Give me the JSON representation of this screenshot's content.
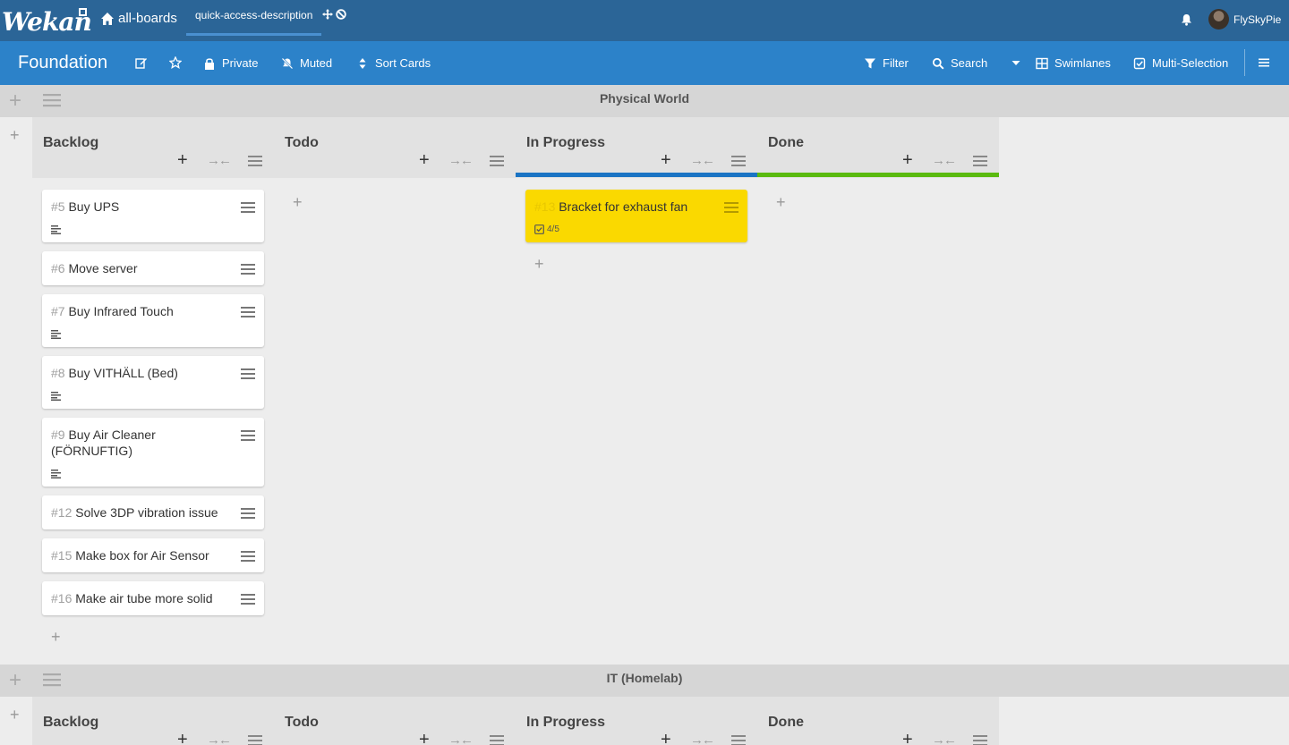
{
  "header": {
    "logo": "Wekan",
    "all_boards": "all-boards",
    "quick_access": "quick-access-description",
    "user": "FlySkyPie"
  },
  "board": {
    "title": "Foundation",
    "private": "Private",
    "muted": "Muted",
    "sort_cards": "Sort Cards",
    "filter": "Filter",
    "search": "Search",
    "swimlanes": "Swimlanes",
    "multi_selection": "Multi-Selection"
  },
  "colors": {
    "header": "#2b6597",
    "boardbar": "#2c82c9",
    "in_progress": "#1a74c4",
    "done": "#5aba0f",
    "yellow_card": "#fad900"
  },
  "swimlanes": [
    {
      "title": "Physical World",
      "lists": [
        {
          "title": "Backlog",
          "cards": [
            {
              "num": "#5",
              "title": "Buy UPS",
              "desc": true
            },
            {
              "num": "#6",
              "title": "Move server"
            },
            {
              "num": "#7",
              "title": "Buy Infrared Touch",
              "desc": true
            },
            {
              "num": "#8",
              "title": "Buy VITHÄLL (Bed)",
              "desc": true
            },
            {
              "num": "#9",
              "title": "Buy Air Cleaner (FÖRNUFTIG)",
              "desc": true
            },
            {
              "num": "#12",
              "title": "Solve 3DP vibration issue"
            },
            {
              "num": "#15",
              "title": "Make box for Air Sensor"
            },
            {
              "num": "#16",
              "title": "Make air tube more solid"
            }
          ]
        },
        {
          "title": "Todo",
          "cards": []
        },
        {
          "title": "In Progress",
          "cards": [
            {
              "num": "#13",
              "title": "Bracket for exhaust fan",
              "checklist": "4/5"
            }
          ]
        },
        {
          "title": "Done",
          "cards": []
        }
      ]
    },
    {
      "title": "IT (Homelab)",
      "lists": [
        {
          "title": "Backlog"
        },
        {
          "title": "Todo"
        },
        {
          "title": "In Progress"
        },
        {
          "title": "Done"
        }
      ]
    }
  ]
}
